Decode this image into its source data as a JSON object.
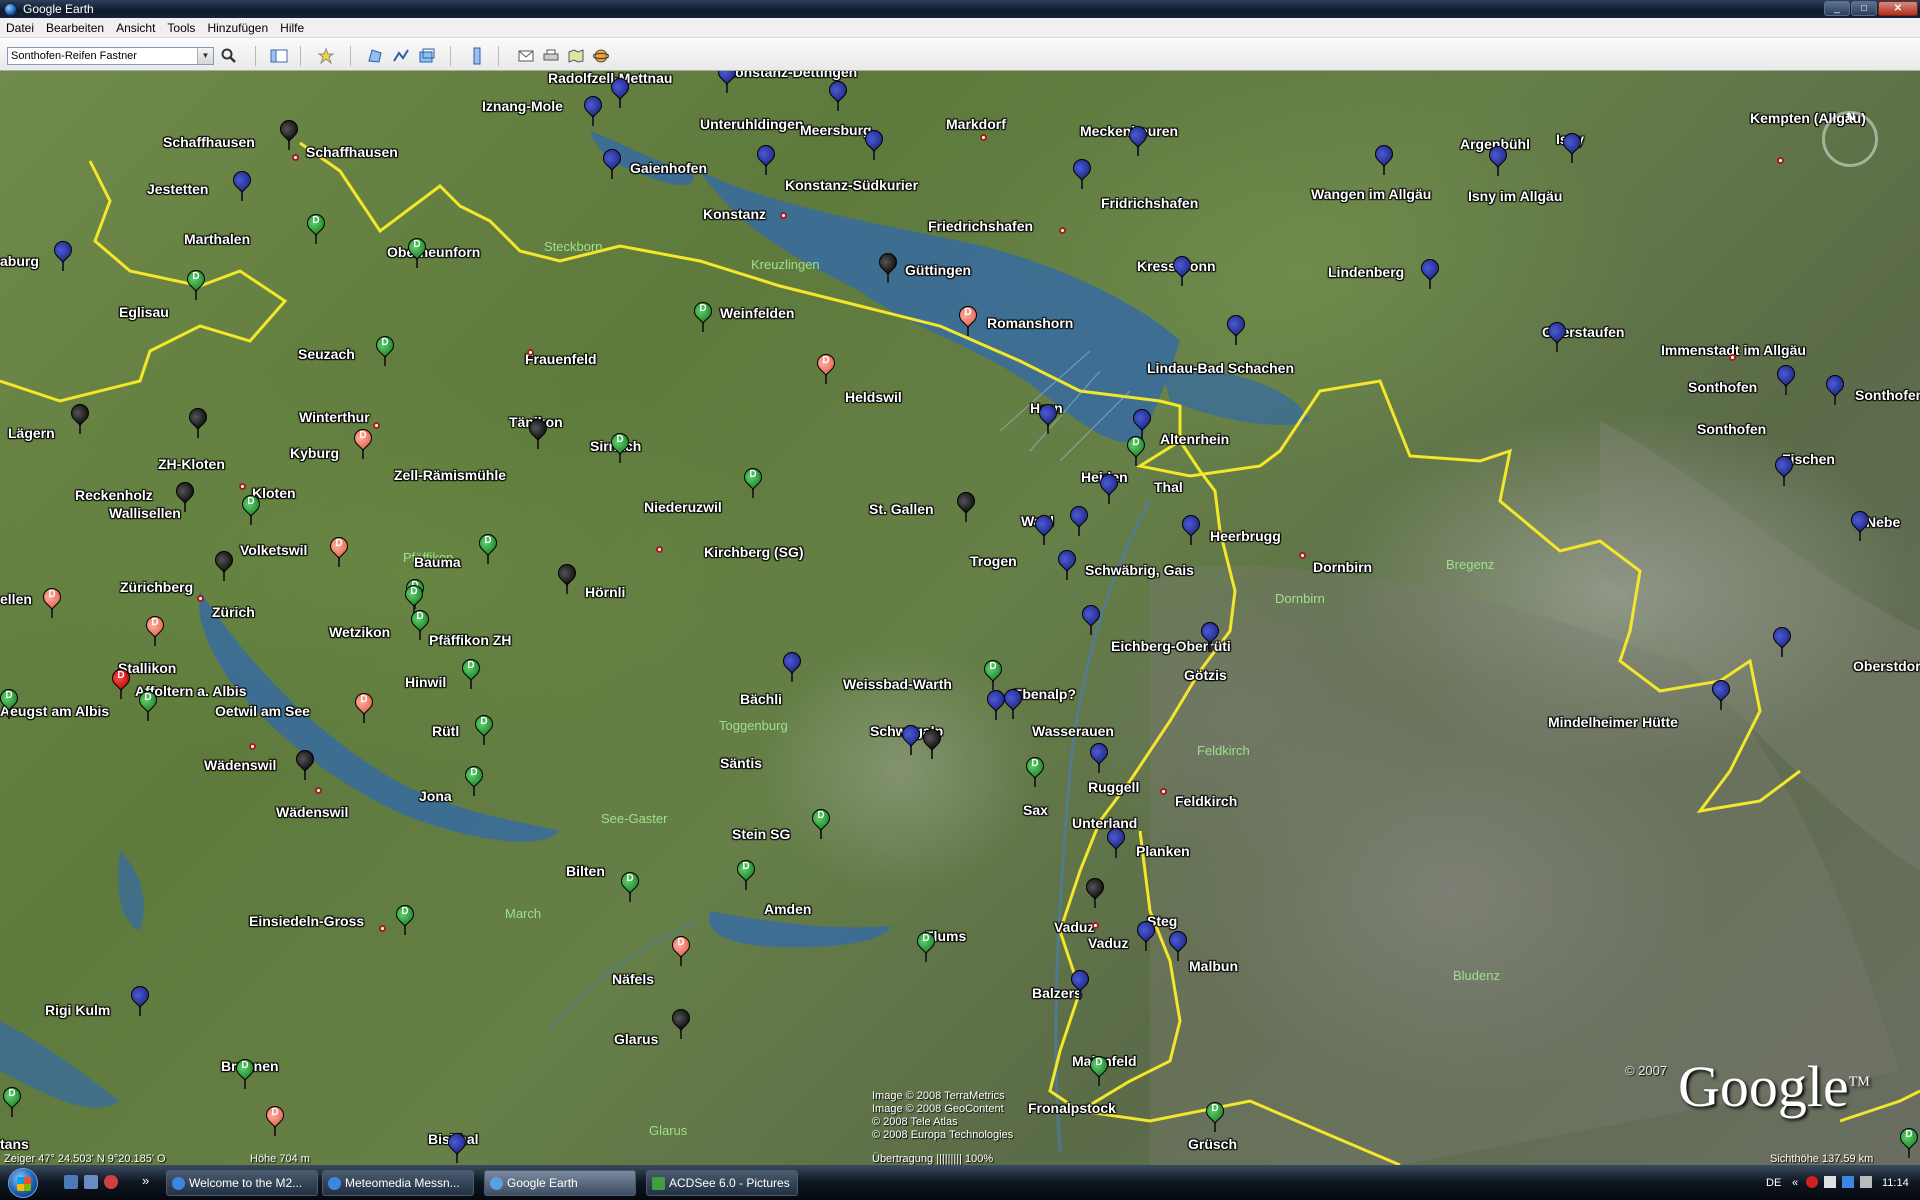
{
  "window": {
    "title": "Google Earth",
    "min": "_",
    "max": "□",
    "close": "✕"
  },
  "menu": [
    "Datei",
    "Bearbeiten",
    "Ansicht",
    "Tools",
    "Hinzufügen",
    "Hilfe"
  ],
  "toolbar": {
    "search_value": "Sonthofen-Reifen Fastner",
    "dropdown_arrow": "▼",
    "search_icon": "🔍"
  },
  "map": {
    "places": [
      {
        "name": "Radolfzell-Mettnau"
      },
      {
        "name": "Konstanz-Dettingen"
      },
      {
        "name": "Iznang-Mole"
      },
      {
        "name": "Unteruhldingen"
      },
      {
        "name": "Meersburg"
      },
      {
        "name": "Markdorf"
      },
      {
        "name": "Meckenbeuren"
      },
      {
        "name": "Argenbühl"
      },
      {
        "name": "Isny"
      },
      {
        "name": "Kempten (Allgäu)"
      },
      {
        "name": "Schaffhausen"
      },
      {
        "name": "Schaffhausen"
      },
      {
        "name": "Gaienhofen"
      },
      {
        "name": "Konstanz-Südkurier"
      },
      {
        "name": "Jestetten"
      },
      {
        "name": "Fridrichshafen"
      },
      {
        "name": "Wangen im Allgäu"
      },
      {
        "name": "Isny im Allgäu"
      },
      {
        "name": "Konstanz"
      },
      {
        "name": "Friedrichshafen"
      },
      {
        "name": "Marthalen"
      },
      {
        "name": "Oberneunforn"
      },
      {
        "name": "Güttingen"
      },
      {
        "name": "Kressbronn"
      },
      {
        "name": "Lindenberg"
      },
      {
        "name": "aburg"
      },
      {
        "name": "Eglisau"
      },
      {
        "name": "Weinfelden"
      },
      {
        "name": "Romanshorn"
      },
      {
        "name": "Oberstaufen"
      },
      {
        "name": "Immenstadt im Allgäu"
      },
      {
        "name": "Seuzach"
      },
      {
        "name": "Frauenfeld"
      },
      {
        "name": "Lindau-Bad Schachen"
      },
      {
        "name": "Heldswil"
      },
      {
        "name": "Sonthofen"
      },
      {
        "name": "Sonthofen"
      },
      {
        "name": "Sonthofen"
      },
      {
        "name": "Winterthur"
      },
      {
        "name": "Tänikon"
      },
      {
        "name": "Horn"
      },
      {
        "name": "Lägern"
      },
      {
        "name": "Altenrhein"
      },
      {
        "name": "Kyburg"
      },
      {
        "name": "Sirnach"
      },
      {
        "name": "ZH-Kloten"
      },
      {
        "name": "Zell-Rämismühle"
      },
      {
        "name": "Heiden"
      },
      {
        "name": "Fischen"
      },
      {
        "name": "Thal"
      },
      {
        "name": "Reckenholz"
      },
      {
        "name": "Kloten"
      },
      {
        "name": "Niederuzwil"
      },
      {
        "name": "Wallisellen"
      },
      {
        "name": "St. Gallen"
      },
      {
        "name": "Wald"
      },
      {
        "name": "Nebe"
      },
      {
        "name": "Volketswil"
      },
      {
        "name": "Kirchberg (SG)"
      },
      {
        "name": "Heerbrugg"
      },
      {
        "name": "Bauma"
      },
      {
        "name": "Trogen"
      },
      {
        "name": "Schwäbrig, Gais"
      },
      {
        "name": "Dornbirn"
      },
      {
        "name": "ellen"
      },
      {
        "name": "Zürichberg"
      },
      {
        "name": "Hörnli"
      },
      {
        "name": "Zürich"
      },
      {
        "name": "Wetzikon"
      },
      {
        "name": "Pfäffikon ZH"
      },
      {
        "name": "Eichberg-Oberrüti"
      },
      {
        "name": "Oberstdorf-Birs"
      },
      {
        "name": "Stallikon"
      },
      {
        "name": "Götzis"
      },
      {
        "name": "Affoltern a. Albis"
      },
      {
        "name": "Hinwil"
      },
      {
        "name": "Weissbad-Warth"
      },
      {
        "name": "Bächli"
      },
      {
        "name": "Ebenalp?"
      },
      {
        "name": "Aeugst am Albis"
      },
      {
        "name": "Oetwil am See"
      },
      {
        "name": "Mindelheimer Hütte"
      },
      {
        "name": "Rütl"
      },
      {
        "name": "Schwägalp"
      },
      {
        "name": "Wasserauen"
      },
      {
        "name": "Wädenswil"
      },
      {
        "name": "Säntis"
      },
      {
        "name": "Ruggell"
      },
      {
        "name": "Jona"
      },
      {
        "name": "Feldkirch"
      },
      {
        "name": "Sax"
      },
      {
        "name": "Wädenswil"
      },
      {
        "name": "Unterland"
      },
      {
        "name": "Stein SG"
      },
      {
        "name": "Planken"
      },
      {
        "name": "Bilten"
      },
      {
        "name": "Einsiedeln-Gross"
      },
      {
        "name": "Amden"
      },
      {
        "name": "Vaduz"
      },
      {
        "name": "Steg"
      },
      {
        "name": "Vaduz"
      },
      {
        "name": "Flums"
      },
      {
        "name": "Malbun"
      },
      {
        "name": "Näfels"
      },
      {
        "name": "Rigi Kulm"
      },
      {
        "name": "Balzers"
      },
      {
        "name": "Glarus"
      },
      {
        "name": "Brunnen"
      },
      {
        "name": "Maienfeld"
      },
      {
        "name": "Fronalpstock"
      },
      {
        "name": "Bisithal"
      },
      {
        "name": "Grüsch"
      },
      {
        "name": "tans"
      }
    ],
    "regions": [
      {
        "name": "Steckborn"
      },
      {
        "name": "Kreuzlingen"
      },
      {
        "name": "Pfäffikon"
      },
      {
        "name": "See-Gaster"
      },
      {
        "name": "Toggenburg"
      },
      {
        "name": "March"
      },
      {
        "name": "Glarus"
      },
      {
        "name": "Bregenz"
      },
      {
        "name": "Dornbirn"
      },
      {
        "name": "Feldkirch"
      },
      {
        "name": "Bludenz"
      }
    ],
    "pin_letters": {
      "green": "D",
      "pink": "D",
      "red": "D"
    },
    "credits": [
      "Image © 2008 TerraMetrics",
      "Image © 2008 GeoContent",
      "© 2008 Tele Atlas",
      "© 2008 Europa Technologies"
    ],
    "copyright_year": "© 2007",
    "logo": "Google",
    "logo_tm": "TM",
    "compass_n": "N",
    "status": {
      "pointer": "Zeiger  47° 24.503' N    9°20.185' O",
      "elevation": "Höhe    704 m",
      "streaming": "Übertragung ||||||||| 100%",
      "eye_alt": "Sichthöhe    137.59 km"
    }
  },
  "taskbar": {
    "tasks": [
      {
        "label": "Welcome to the M2..."
      },
      {
        "label": "Meteomedia Messn..."
      },
      {
        "label": "Google Earth"
      },
      {
        "label": "ACDSee 6.0 - Pictures"
      }
    ],
    "overflow": "»",
    "lang": "DE",
    "clock": "11:14"
  }
}
